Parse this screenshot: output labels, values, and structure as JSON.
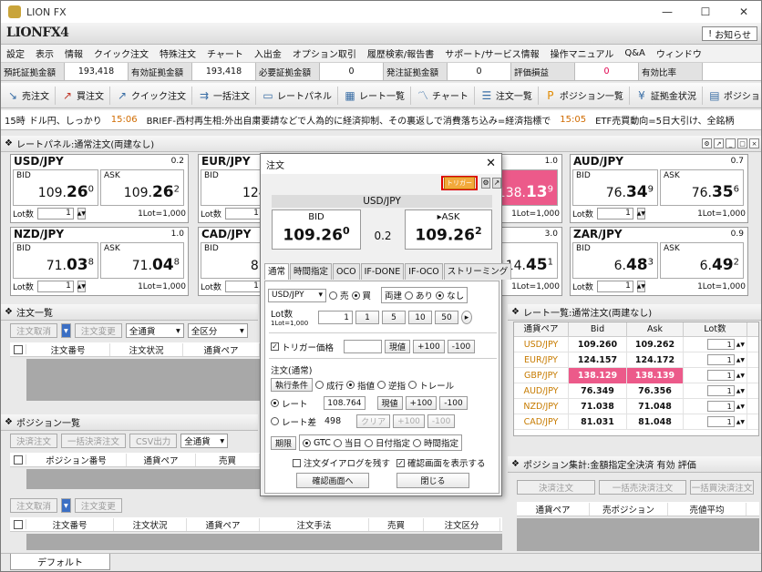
{
  "window": {
    "title": "LION FX",
    "logo": "LIONFX4",
    "notice": "お知らせ"
  },
  "menu": [
    "設定",
    "表示",
    "情報",
    "クイック注文",
    "特殊注文",
    "チャート",
    "入出金",
    "オプション取引",
    "履歴検索/報告書",
    "サポート/サービス情報",
    "操作マニュアル",
    "Q&A",
    "ウィンドウ"
  ],
  "margin": [
    {
      "label": "預託証拠金額",
      "value": "193,418"
    },
    {
      "label": "有効証拠金額",
      "value": "193,418"
    },
    {
      "label": "必要証拠金額",
      "value": "0"
    },
    {
      "label": "発注証拠金額",
      "value": "0"
    },
    {
      "label": "評価損益",
      "value": "0"
    },
    {
      "label": "有効比率",
      "value": ""
    }
  ],
  "toolbar": [
    "売注文",
    "買注文",
    "クイック注文",
    "一括注文",
    "レートパネル",
    "レート一覧",
    "チャート",
    "注文一覧",
    "ポジション一覧",
    "証拠金状況",
    "ポジション集計"
  ],
  "ticker": [
    {
      "time": "15時",
      "text": "ドル円、しっかり"
    },
    {
      "time": "15:06",
      "text": "BRIEF-西村再生相:外出自粛要請などで人為的に経済抑制、その裏返しで消費落ち込み=経済指標で"
    },
    {
      "time": "15:05",
      "text": "ETF売買動向=5日大引け、全銘柄"
    }
  ],
  "rate_panel": {
    "title": "レートパネル:通常注文(両建なし)",
    "bid_label": "BID",
    "ask_label": "ASK",
    "lot_label": "Lot数",
    "lot_value": "1",
    "lot_total": "1Lot=1,000",
    "tiles": [
      {
        "pair": "USD/JPY",
        "spread": "0.2",
        "bid_a": "109.",
        "bid_b": "26",
        "bid_c": "0",
        "ask_a": "109.",
        "ask_b": "26",
        "ask_c": "2"
      },
      {
        "pair": "EUR/JPY",
        "spread": "",
        "bid_a": "124.",
        "bid_b": "1",
        "bid_c": "",
        "ask_a": "",
        "ask_b": "",
        "ask_c": ""
      },
      {
        "pair": "GBP/JPY",
        "spread": "1.0",
        "bid_a": "",
        "bid_b": "",
        "bid_c": "",
        "ask_a": "138.",
        "ask_b": "13",
        "ask_c": "9"
      },
      {
        "pair": "AUD/JPY",
        "spread": "0.7",
        "bid_a": "76.",
        "bid_b": "34",
        "bid_c": "9",
        "ask_a": "76.",
        "ask_b": "35",
        "ask_c": "6"
      },
      {
        "pair": "NZD/JPY",
        "spread": "1.0",
        "bid_a": "71.",
        "bid_b": "03",
        "bid_c": "8",
        "ask_a": "71.",
        "ask_b": "04",
        "ask_c": "8"
      },
      {
        "pair": "CAD/JPY",
        "spread": "",
        "bid_a": "81.",
        "bid_b": "0",
        "bid_c": "",
        "ask_a": "",
        "ask_b": "",
        "ask_c": ""
      },
      {
        "pair": "",
        "spread": "3.0",
        "bid_a": "",
        "bid_b": "",
        "bid_c": "",
        "ask_a": "114.",
        "ask_b": "45",
        "ask_c": "1"
      },
      {
        "pair": "ZAR/JPY",
        "spread": "0.9",
        "bid_a": "6.",
        "bid_b": "48",
        "bid_c": "3",
        "ask_a": "6.",
        "ask_b": "49",
        "ask_c": "2"
      }
    ]
  },
  "order_list": {
    "title": "注文一覧",
    "btn_cancel": "注文取消",
    "btn_change": "注文変更",
    "filter1": "全通貨",
    "filter2": "全区分",
    "cols": [
      "注文番号",
      "注文状況",
      "通貨ペア"
    ]
  },
  "position_list": {
    "title": "ポジション一覧",
    "btn1": "決済注文",
    "btn2": "一括決済注文",
    "btn3": "CSV出力",
    "filter": "全通貨",
    "cols": [
      "ポジション番号",
      "通貨ペア",
      "売買"
    ]
  },
  "bottom_list": {
    "btn_cancel": "注文取消",
    "btn_change": "注文変更",
    "cols": [
      "注文番号",
      "注文状況",
      "通貨ペア",
      "注文手法",
      "売買",
      "注文区分"
    ]
  },
  "rate_list": {
    "title": "レート一覧:通常注文(両建なし)",
    "cols": [
      "通貨ペア",
      "Bid",
      "Ask",
      "Lot数"
    ],
    "rows": [
      {
        "pair": "USD/JPY",
        "bid": "109.260",
        "ask": "109.262",
        "lot": "1"
      },
      {
        "pair": "EUR/JPY",
        "bid": "124.157",
        "ask": "124.172",
        "lot": "1"
      },
      {
        "pair": "GBP/JPY",
        "bid": "138.129",
        "ask": "138.139",
        "lot": "1"
      },
      {
        "pair": "AUD/JPY",
        "bid": "76.349",
        "ask": "76.356",
        "lot": "1"
      },
      {
        "pair": "NZD/JPY",
        "bid": "71.038",
        "ask": "71.048",
        "lot": "1"
      },
      {
        "pair": "CAD/JPY",
        "bid": "81.031",
        "ask": "81.048",
        "lot": "1"
      }
    ]
  },
  "position_summary": {
    "title": "ポジション集計:金額指定全決済 有効 評価",
    "btn1": "決済注文",
    "btn2": "一括売決済注文",
    "btn3": "一括買決済注文",
    "cols": [
      "通貨ペア",
      "売ポジション",
      "売値平均"
    ]
  },
  "status_tab": "デフォルト",
  "dialog": {
    "title": "注文",
    "trigger_badge": "トリガー",
    "pair": "USD/JPY",
    "bid_label": "BID",
    "ask_label": "▸ASK",
    "bid": "109.26",
    "bid_sup": "0",
    "ask": "109.26",
    "ask_sup": "2",
    "spread": "0.2",
    "tabs": [
      "通常",
      "時間指定",
      "OCO",
      "IF-DONE",
      "IF-OCO",
      "ストリーミング"
    ],
    "pair_select": "USD/JPY",
    "sell": "売",
    "buy": "買",
    "hedge": "両建",
    "ari": "あり",
    "nashi": "なし",
    "lot_label": "Lot数",
    "lot_sub": "1Lot=1,000",
    "lot_value": "1",
    "lot_btns": [
      "1",
      "5",
      "10",
      "50"
    ],
    "trigger_label": "トリガー価格",
    "current": "現値",
    "plus100": "+100",
    "minus100": "-100",
    "order_type": "注文(通常)",
    "exec_label": "執行条件",
    "exec": [
      "成行",
      "指値",
      "逆指",
      "トレール"
    ],
    "rate": "レート",
    "rate_value": "108.764",
    "rate_diff": "レート差",
    "diff_value": "498",
    "clear": "クリア",
    "period": "期限",
    "periods": [
      "GTC",
      "当日",
      "日付指定",
      "時間指定"
    ],
    "skip_dialog": "注文ダイアログを残す",
    "confirm": "確認画面を表示する",
    "confirm_btn": "確認画面へ",
    "close_btn": "閉じる"
  }
}
